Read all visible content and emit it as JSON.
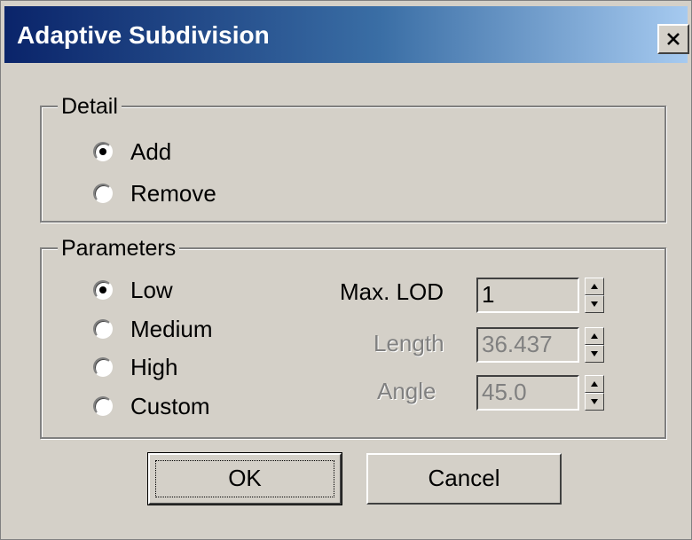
{
  "window": {
    "title": "Adaptive Subdivision"
  },
  "detail": {
    "label": "Detail",
    "options": [
      {
        "label": "Add",
        "checked": true
      },
      {
        "label": "Remove",
        "checked": false
      }
    ]
  },
  "parameters": {
    "label": "Parameters",
    "options": [
      {
        "label": "Low",
        "checked": true
      },
      {
        "label": "Medium",
        "checked": false
      },
      {
        "label": "High",
        "checked": false
      },
      {
        "label": "Custom",
        "checked": false
      }
    ],
    "fields": {
      "max_lod": {
        "label": "Max. LOD",
        "value": "1",
        "enabled": true
      },
      "length": {
        "label": "Length",
        "value": "36.437",
        "enabled": false
      },
      "angle": {
        "label": "Angle",
        "value": "45.0",
        "enabled": false
      }
    }
  },
  "buttons": {
    "ok": "OK",
    "cancel": "Cancel"
  },
  "icons": {
    "close": "close-icon",
    "spin_up": "spin-up-arrow-icon",
    "spin_down": "spin-down-arrow-icon"
  }
}
